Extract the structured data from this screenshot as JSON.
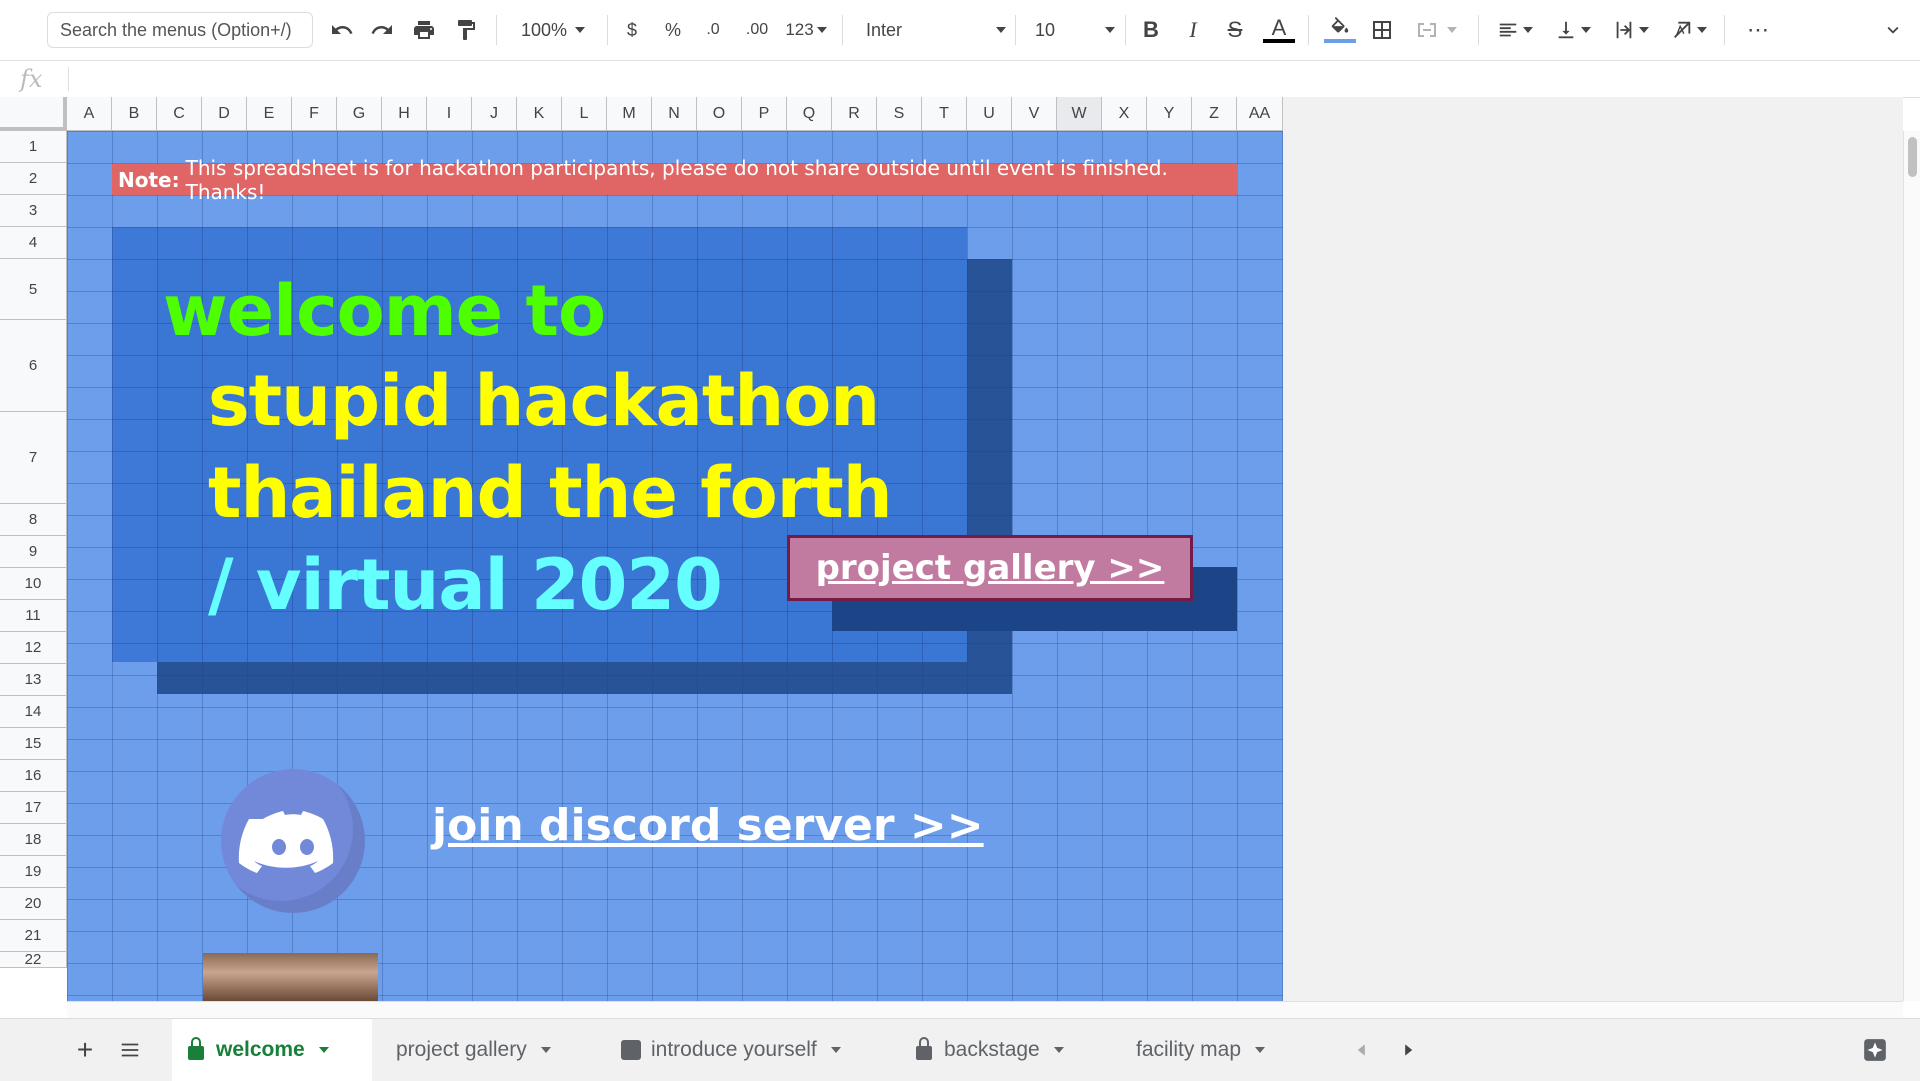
{
  "toolbar": {
    "search_placeholder": "Search the menus (Option+/)",
    "zoom": "100%",
    "currency": "$",
    "percent": "%",
    "decrease_decimal": ".0",
    "increase_decimal": ".00",
    "number_format": "123",
    "font": "Inter",
    "font_size": "10",
    "bold": "B",
    "italic": "I",
    "strike": "S",
    "text_color": "A",
    "more": "⋯"
  },
  "formula_bar": {
    "fx": "fx"
  },
  "columns": [
    "A",
    "B",
    "C",
    "D",
    "E",
    "F",
    "G",
    "H",
    "I",
    "J",
    "K",
    "L",
    "M",
    "N",
    "O",
    "P",
    "Q",
    "R",
    "S",
    "T",
    "U",
    "V",
    "W",
    "X",
    "Y",
    "Z",
    "AA"
  ],
  "rows": [
    "1",
    "2",
    "3",
    "4",
    "5",
    "6",
    "7",
    "8",
    "9",
    "10",
    "11",
    "12",
    "13",
    "14",
    "15",
    "16",
    "17",
    "18",
    "19",
    "20",
    "21",
    "22"
  ],
  "sheet": {
    "note_label": "Note:",
    "note_text": "This spreadsheet is for hackathon participants, please do not share outside until event is finished. Thanks!",
    "title_line1": "welcome to",
    "title_line2": "stupid hackathon",
    "title_line3": "thailand the forth",
    "title_line4": "/ virtual 2020",
    "gallery_button": "project gallery >>",
    "discord_link": "join discord server >>"
  },
  "tabs": [
    {
      "label": "welcome",
      "active": true
    },
    {
      "label": "project gallery"
    },
    {
      "label": "introduce yourself"
    },
    {
      "label": "backstage"
    },
    {
      "label": "facility map"
    }
  ],
  "colors": {
    "sheet_bg": "#6d9eeb",
    "panel": "#3c78d8",
    "shadow": "#1c4587",
    "note_bg": "#e06666",
    "green_title": "#4dff00",
    "yellow_title": "#ffff00",
    "cyan_title": "#66ffff",
    "button_bg": "#c27ba0",
    "button_border": "#741b47",
    "discord": "#7289da"
  }
}
